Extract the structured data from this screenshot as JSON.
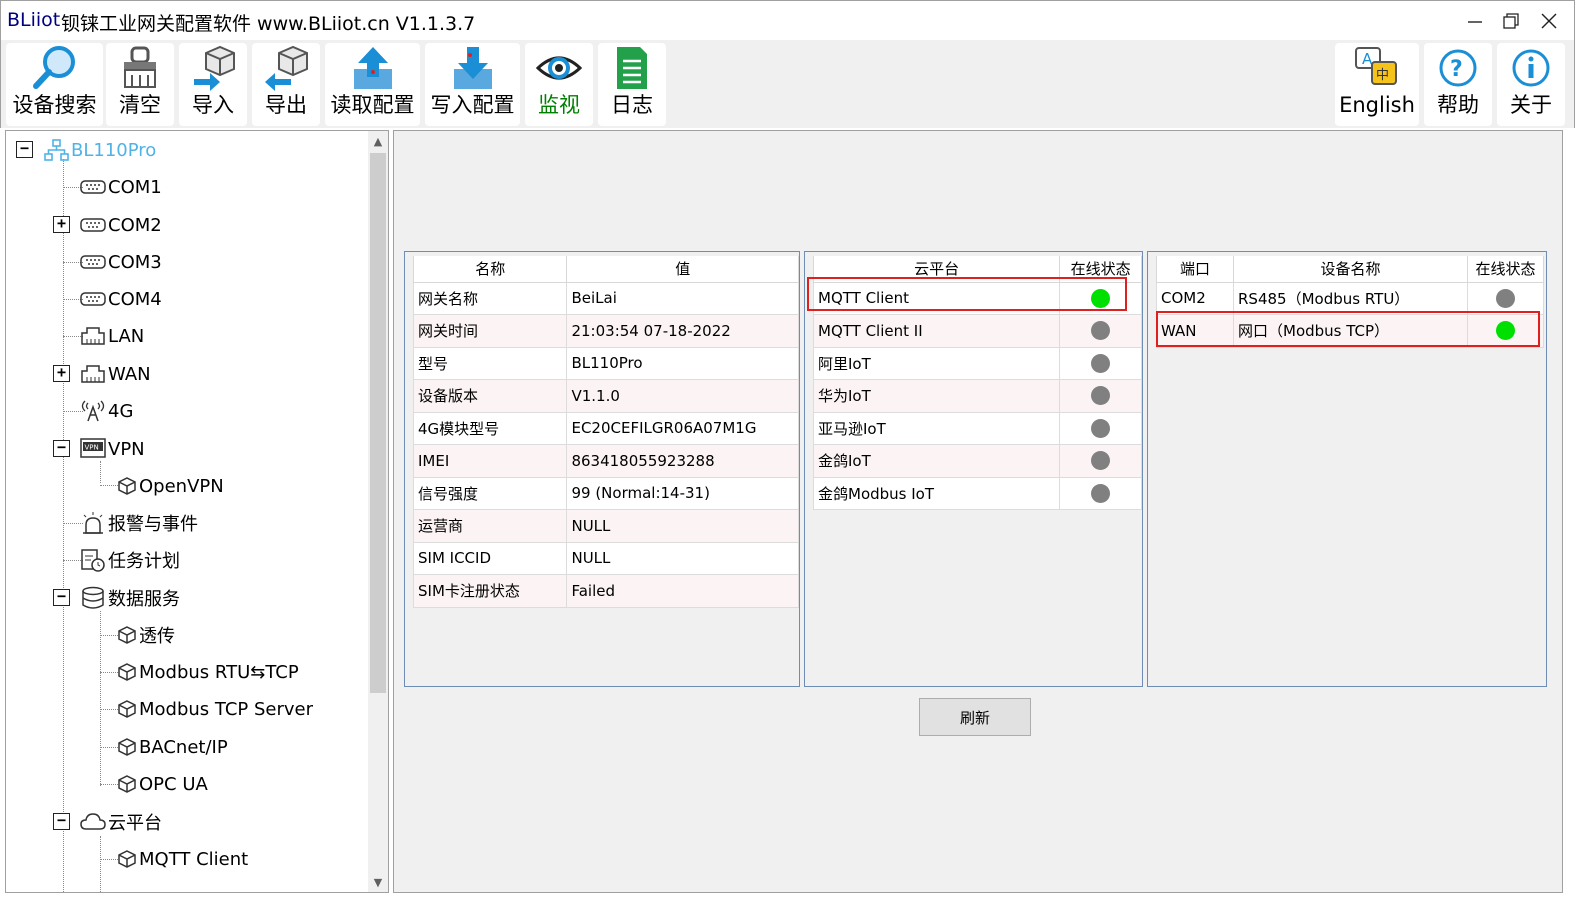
{
  "window": {
    "brand": "BLiiot",
    "title": "钡铼工业网关配置软件 www.BLiiot.cn V1.1.3.7",
    "minimize_icon": "minimize-icon",
    "maximize_icon": "restore-icon",
    "close_icon": "close-icon"
  },
  "toolbar": {
    "search": "设备搜索",
    "clear": "清空",
    "import": "导入",
    "export": "导出",
    "read_config": "读取配置",
    "write_config": "写入配置",
    "monitor": "监视",
    "log": "日志",
    "english": "English",
    "help": "帮助",
    "about": "关于"
  },
  "tree": {
    "root": "BL110Pro",
    "com1": "COM1",
    "com2": "COM2",
    "com3": "COM3",
    "com4": "COM4",
    "lan": "LAN",
    "wan": "WAN",
    "g4": "4G",
    "vpn": "VPN",
    "openvpn": "OpenVPN",
    "alarm": "报警与事件",
    "task": "任务计划",
    "data_service": "数据服务",
    "passthrough": "透传",
    "modbus_rtu_tcp": "Modbus RTU⇆TCP",
    "modbus_tcp_server": "Modbus TCP Server",
    "bacnet": "BACnet/IP",
    "opcua": "OPC UA",
    "cloud": "云平台",
    "mqtt_client": "MQTT Client"
  },
  "info_table": {
    "headers": [
      "名称",
      "值"
    ],
    "rows": [
      [
        "网关名称",
        "BeiLai"
      ],
      [
        "网关时间",
        "21:03:54 07-18-2022"
      ],
      [
        "型号",
        "BL110Pro"
      ],
      [
        "设备版本",
        "V1.1.0"
      ],
      [
        "4G模块型号",
        "EC20CEFILGR06A07M1G"
      ],
      [
        "IMEI",
        "863418055923288"
      ],
      [
        "信号强度",
        "99 (Normal:14-31)"
      ],
      [
        "运营商",
        "NULL"
      ],
      [
        "SIM ICCID",
        "NULL"
      ],
      [
        "SIM卡注册状态",
        "Failed"
      ]
    ]
  },
  "cloud_table": {
    "headers": [
      "云平台",
      "在线状态"
    ],
    "rows": [
      {
        "name": "MQTT Client",
        "online": true
      },
      {
        "name": "MQTT Client II",
        "online": false
      },
      {
        "name": "阿里IoT",
        "online": false
      },
      {
        "name": "华为IoT",
        "online": false
      },
      {
        "name": "亚马逊IoT",
        "online": false
      },
      {
        "name": "金鸽IoT",
        "online": false
      },
      {
        "name": "金鸽Modbus IoT",
        "online": false
      }
    ]
  },
  "port_table": {
    "headers": [
      "端口",
      "设备名称",
      "在线状态"
    ],
    "rows": [
      {
        "port": "COM2",
        "device": "RS485（Modbus RTU）",
        "online": false
      },
      {
        "port": "WAN",
        "device": "网口（Modbus TCP）",
        "online": true
      }
    ]
  },
  "refresh_label": "刷新",
  "colors": {
    "online": "#00e000",
    "offline": "#808080",
    "highlight": "#e0201e",
    "monitor_active": "#008000",
    "tree_root": "#4fb3e6"
  }
}
